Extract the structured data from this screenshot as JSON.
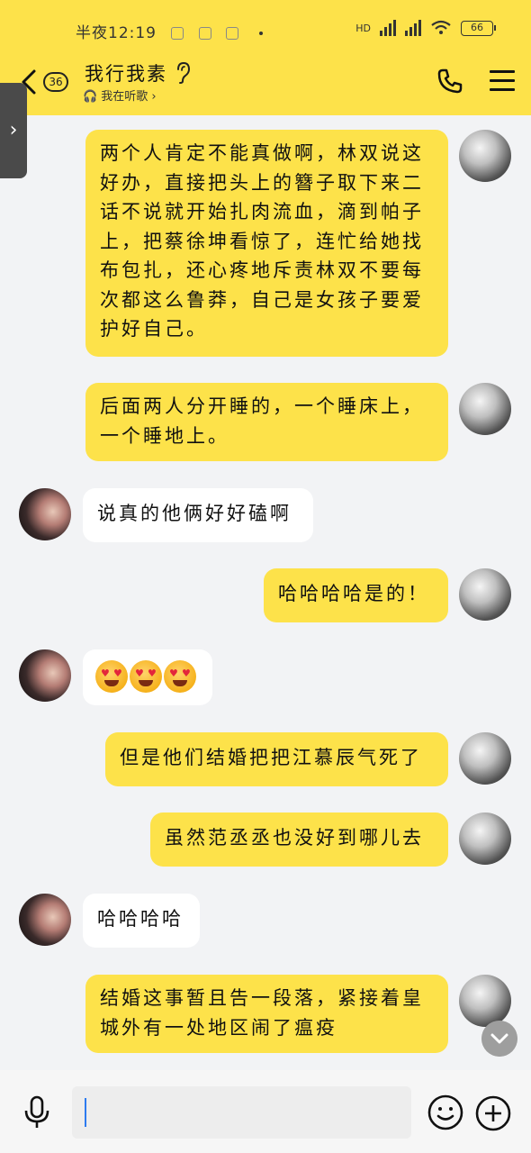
{
  "status_bar": {
    "time": "半夜12:19",
    "battery": "66",
    "network": "HD"
  },
  "header": {
    "unread_count": "36",
    "title": "我行我素",
    "subtitle": "我在听歌",
    "icons": [
      "back-icon",
      "ear-icon",
      "phone-icon",
      "menu-icon"
    ]
  },
  "side_tab": {
    "label": "›"
  },
  "messages": [
    {
      "from": "me",
      "text": "两个人肯定不能真做啊，林双说这好办，直接把头上的簪子取下来二话不说就开始扎肉流血，滴到帕子上，把蔡徐坤看惊了，连忙给她找布包扎，还心疼地斥责林双不要每次都这么鲁莽，自己是女孩子要爱护好自己。"
    },
    {
      "from": "me",
      "text": "后面两人分开睡的，一个睡床上，一个睡地上。"
    },
    {
      "from": "them",
      "text": "说真的他俩好好磕啊"
    },
    {
      "from": "me",
      "text": "哈哈哈哈是的！"
    },
    {
      "from": "them",
      "text": "",
      "emoji": [
        "heart-eyes",
        "heart-eyes",
        "heart-eyes"
      ]
    },
    {
      "from": "me",
      "text": "但是他们结婚把把江慕辰气死了"
    },
    {
      "from": "me",
      "text": "虽然范丞丞也没好到哪儿去"
    },
    {
      "from": "them",
      "text": "哈哈哈哈"
    },
    {
      "from": "me",
      "text": "结婚这事暂且告一段落，紧接着皇城外有一处地区闹了瘟疫"
    }
  ],
  "input": {
    "value": "",
    "placeholder": ""
  },
  "colors": {
    "accent": "#fde24a",
    "background": "#f2f3f5",
    "bubble_them": "#ffffff"
  }
}
